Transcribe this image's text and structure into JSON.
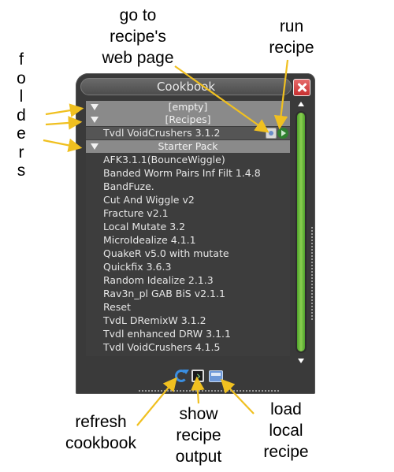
{
  "annotations": {
    "web_page": [
      "go to",
      "recipe's",
      "web page"
    ],
    "run": [
      "run",
      "recipe"
    ],
    "folders": [
      "f",
      "o",
      "l",
      "d",
      "e",
      "r",
      "s"
    ],
    "refresh": [
      "refresh",
      "cookbook"
    ],
    "output": [
      "show",
      "recipe",
      "output"
    ],
    "local": [
      "load",
      "local",
      "recipe"
    ]
  },
  "window": {
    "title": "Cookbook"
  },
  "folders": [
    {
      "name": "[empty]",
      "recipes": []
    },
    {
      "name": "[Recipes]",
      "recipes": [
        "Tvdl VoidCrushers 3.1.2"
      ]
    },
    {
      "name": "Starter Pack",
      "recipes": [
        "AFK3.1.1(BounceWiggle)",
        "Banded Worm Pairs Inf Filt 1.4.8",
        "BandFuze.",
        "Cut And Wiggle v2",
        "Fracture v2.1",
        "Local Mutate 3.2",
        "MicroIdealize 4.1.1",
        "QuakeR v5.0 with mutate",
        "Quickfix 3.6.3",
        "Random Idealize 2.1.3",
        "Rav3n_pl GAB BiS v2.1.1",
        "Reset",
        "TvdL DRemixW 3.1.2",
        "Tvdl enhanced DRW 3.1.1",
        "Tvdl VoidCrushers 4.1.5"
      ]
    }
  ],
  "colors": {
    "window_bg": "#3a3a3a",
    "folder_row": "#8a8a8a",
    "scroll_thumb": "#8ad04f",
    "annotation_arrow": "#f0c020"
  },
  "icons": {
    "web": "web-page-icon",
    "run": "run-recipe-icon",
    "refresh": "refresh-icon",
    "output": "terminal-icon",
    "local": "folder-icon"
  }
}
